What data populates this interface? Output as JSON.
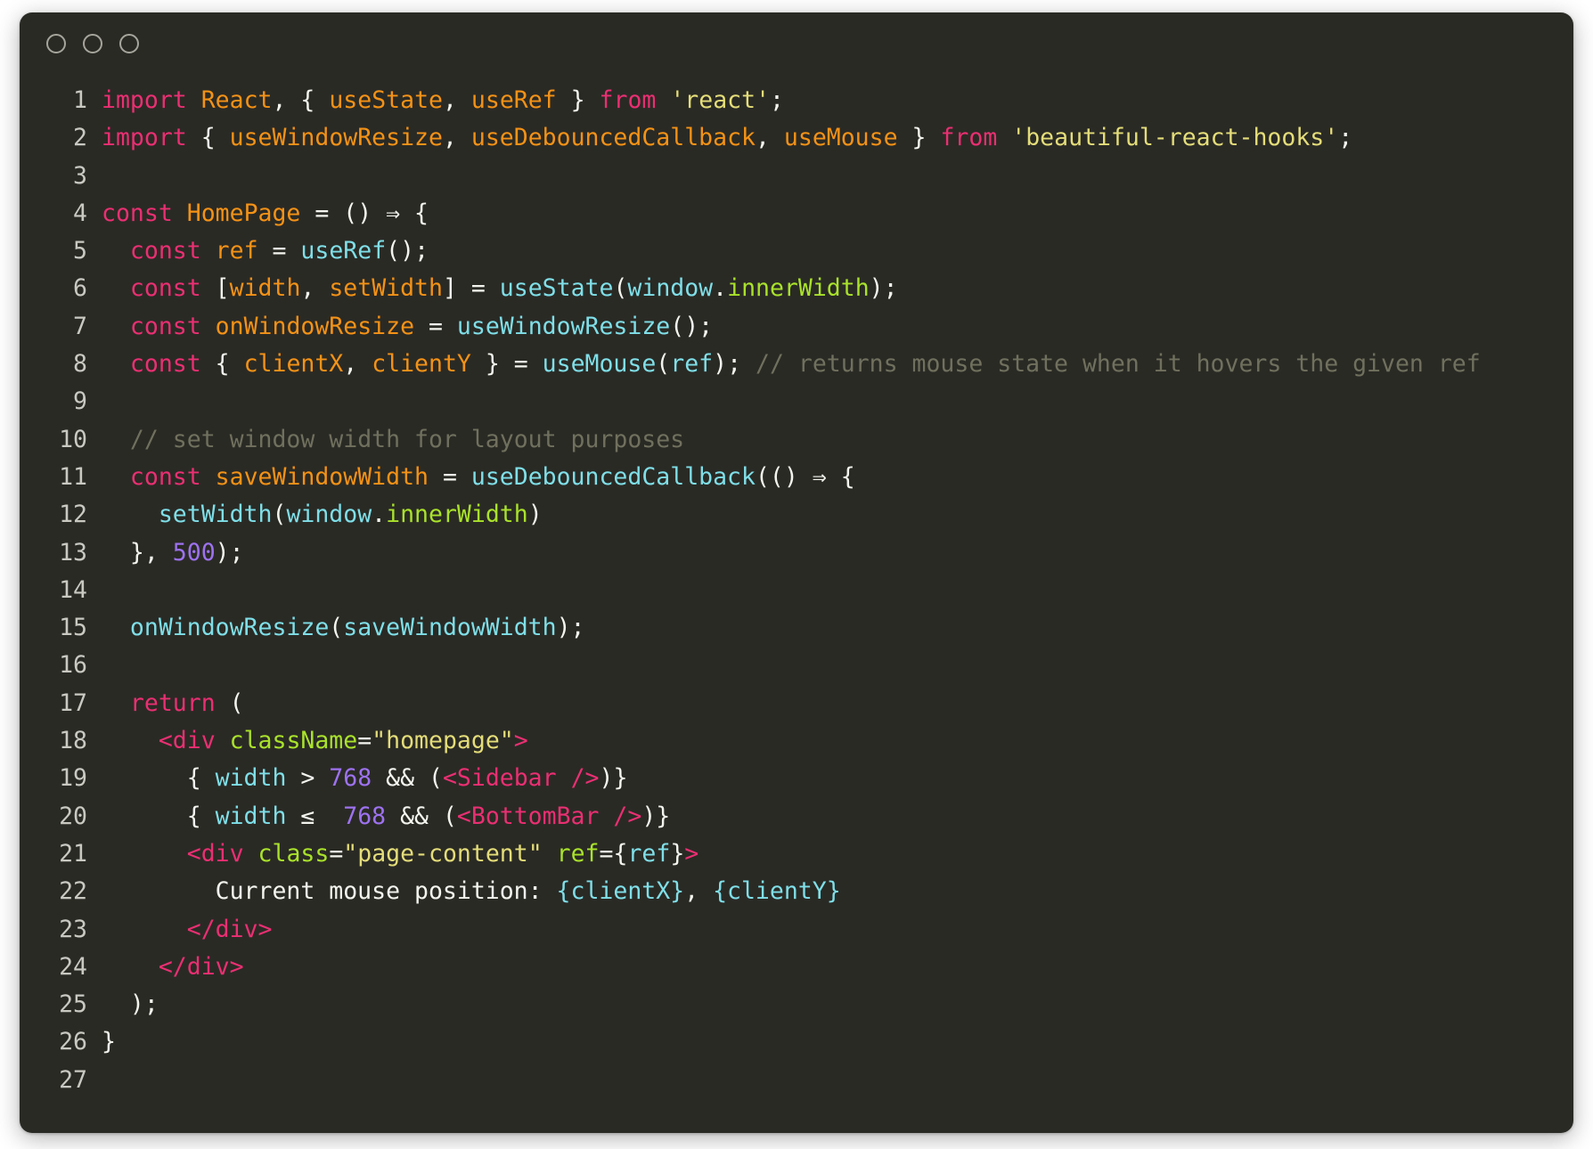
{
  "window": {
    "traffic_lights": [
      "close-button",
      "minimize-button",
      "zoom-button"
    ],
    "background_color": "#2a2a25",
    "page_background": "#ffffff"
  },
  "theme": {
    "keyword_color": "#ea2f72",
    "variable_color": "#f49216",
    "function_color": "#7fdfe8",
    "property_color": "#a9e22b",
    "string_color": "#e4dd79",
    "number_color": "#9d72f0",
    "comment_color": "#70705e",
    "plain_color": "#f4f4ee",
    "linenumber_color": "#c9c9c2"
  },
  "editor": {
    "language": "jsx",
    "line_count": 27,
    "line_numbers": [
      "1",
      "2",
      "3",
      "4",
      "5",
      "6",
      "7",
      "8",
      "9",
      "10",
      "11",
      "12",
      "13",
      "14",
      "15",
      "16",
      "17",
      "18",
      "19",
      "20",
      "21",
      "22",
      "23",
      "24",
      "25",
      "26",
      "27"
    ],
    "lines_plain": [
      "import React, { useState, useRef } from 'react';",
      "import { useWindowResize, useDebouncedCallback, useMouse } from 'beautiful-react-hooks';",
      "",
      "const HomePage = () ⇒ {",
      "  const ref = useRef();",
      "  const [width, setWidth] = useState(window.innerWidth);",
      "  const onWindowResize = useWindowResize();",
      "  const { clientX, clientY } = useMouse(ref); // returns mouse state when it hovers the given ref",
      "",
      "  // set window width for layout purposes",
      "  const saveWindowWidth = useDebouncedCallback(() ⇒ {",
      "    setWidth(window.innerWidth)",
      "  }, 500);",
      "",
      "  onWindowResize(saveWindowWidth);",
      "",
      "  return (",
      "    <div className=\"homepage\">",
      "      { width > 768 && (<Sidebar />)}",
      "      { width ≤ 768 && (<BottomBar />)}",
      "      <div class=\"page-content\" ref={ref}>",
      "        Current mouse position: {clientX}, {clientY}",
      "      </div>",
      "    </div>",
      "  );",
      "}",
      ""
    ],
    "lines_tokens": [
      [
        [
          "import",
          "kw"
        ],
        [
          " ",
          "pun"
        ],
        [
          "React",
          "var"
        ],
        [
          ", ",
          "pun"
        ],
        [
          "{",
          "pun"
        ],
        [
          " ",
          "pun"
        ],
        [
          "useState",
          "var"
        ],
        [
          ", ",
          "pun"
        ],
        [
          "useRef",
          "var"
        ],
        [
          " ",
          "pun"
        ],
        [
          "}",
          "pun"
        ],
        [
          " ",
          "pun"
        ],
        [
          "from",
          "kw"
        ],
        [
          " ",
          "pun"
        ],
        [
          "'react'",
          "str"
        ],
        [
          ";",
          "pun"
        ]
      ],
      [
        [
          "import",
          "kw"
        ],
        [
          " ",
          "pun"
        ],
        [
          "{",
          "pun"
        ],
        [
          " ",
          "pun"
        ],
        [
          "useWindowResize",
          "var"
        ],
        [
          ", ",
          "pun"
        ],
        [
          "useDebouncedCallback",
          "var"
        ],
        [
          ", ",
          "pun"
        ],
        [
          "useMouse",
          "var"
        ],
        [
          " ",
          "pun"
        ],
        [
          "}",
          "pun"
        ],
        [
          " ",
          "pun"
        ],
        [
          "from",
          "kw"
        ],
        [
          " ",
          "pun"
        ],
        [
          "'beautiful-react-hooks'",
          "str"
        ],
        [
          ";",
          "pun"
        ]
      ],
      [],
      [
        [
          "const",
          "kw"
        ],
        [
          " ",
          "pun"
        ],
        [
          "HomePage",
          "var"
        ],
        [
          " = () ⇒ {",
          "pun"
        ]
      ],
      [
        [
          "  ",
          "pun"
        ],
        [
          "const",
          "kw"
        ],
        [
          " ",
          "pun"
        ],
        [
          "ref",
          "var"
        ],
        [
          " = ",
          "pun"
        ],
        [
          "useRef",
          "fn"
        ],
        [
          "();",
          "pun"
        ]
      ],
      [
        [
          "  ",
          "pun"
        ],
        [
          "const",
          "kw"
        ],
        [
          " [",
          "pun"
        ],
        [
          "width",
          "var"
        ],
        [
          ", ",
          "pun"
        ],
        [
          "setWidth",
          "var"
        ],
        [
          "] = ",
          "pun"
        ],
        [
          "useState",
          "fn"
        ],
        [
          "(",
          "pun"
        ],
        [
          "window",
          "fn"
        ],
        [
          ".",
          "pun"
        ],
        [
          "innerWidth",
          "prop"
        ],
        [
          ");",
          "pun"
        ]
      ],
      [
        [
          "  ",
          "pun"
        ],
        [
          "const",
          "kw"
        ],
        [
          " ",
          "pun"
        ],
        [
          "onWindowResize",
          "var"
        ],
        [
          " = ",
          "pun"
        ],
        [
          "useWindowResize",
          "fn"
        ],
        [
          "();",
          "pun"
        ]
      ],
      [
        [
          "  ",
          "pun"
        ],
        [
          "const",
          "kw"
        ],
        [
          " { ",
          "pun"
        ],
        [
          "clientX",
          "var"
        ],
        [
          ", ",
          "pun"
        ],
        [
          "clientY",
          "var"
        ],
        [
          " } = ",
          "pun"
        ],
        [
          "useMouse",
          "fn"
        ],
        [
          "(",
          "pun"
        ],
        [
          "ref",
          "fn"
        ],
        [
          "); ",
          "pun"
        ],
        [
          "// returns mouse state when it hovers the given ref",
          "com"
        ]
      ],
      [],
      [
        [
          "  ",
          "pun"
        ],
        [
          "// set window width for layout purposes",
          "com"
        ]
      ],
      [
        [
          "  ",
          "pun"
        ],
        [
          "const",
          "kw"
        ],
        [
          " ",
          "pun"
        ],
        [
          "saveWindowWidth",
          "var"
        ],
        [
          " = ",
          "pun"
        ],
        [
          "useDebouncedCallback",
          "fn"
        ],
        [
          "(() ⇒ {",
          "pun"
        ]
      ],
      [
        [
          "    ",
          "pun"
        ],
        [
          "setWidth",
          "fn"
        ],
        [
          "(",
          "pun"
        ],
        [
          "window",
          "fn"
        ],
        [
          ".",
          "pun"
        ],
        [
          "innerWidth",
          "prop"
        ],
        [
          ")",
          "pun"
        ]
      ],
      [
        [
          "  }, ",
          "pun"
        ],
        [
          "500",
          "num"
        ],
        [
          ");",
          "pun"
        ]
      ],
      [],
      [
        [
          "  ",
          "pun"
        ],
        [
          "onWindowResize",
          "fn"
        ],
        [
          "(",
          "pun"
        ],
        [
          "saveWindowWidth",
          "fn"
        ],
        [
          ");",
          "pun"
        ]
      ],
      [],
      [
        [
          "  ",
          "pun"
        ],
        [
          "return",
          "kw"
        ],
        [
          " (",
          "pun"
        ]
      ],
      [
        [
          "    ",
          "pun"
        ],
        [
          "<div",
          "tag"
        ],
        [
          " ",
          "pun"
        ],
        [
          "className",
          "prop"
        ],
        [
          "=",
          "pun"
        ],
        [
          "\"homepage\"",
          "str"
        ],
        [
          ">",
          "tag"
        ]
      ],
      [
        [
          "      { ",
          "pun"
        ],
        [
          "width",
          "fn"
        ],
        [
          " > ",
          "pun"
        ],
        [
          "768",
          "num"
        ],
        [
          " && (",
          "pun"
        ],
        [
          "<Sidebar",
          "tag"
        ],
        [
          " ",
          "pun"
        ],
        [
          "/>",
          "tag"
        ],
        [
          ")}",
          "pun"
        ]
      ],
      [
        [
          "      { ",
          "pun"
        ],
        [
          "width",
          "fn"
        ],
        [
          " ≤  ",
          "pun"
        ],
        [
          "768",
          "num"
        ],
        [
          " && (",
          "pun"
        ],
        [
          "<BottomBar",
          "tag"
        ],
        [
          " ",
          "pun"
        ],
        [
          "/>",
          "tag"
        ],
        [
          ")}",
          "pun"
        ]
      ],
      [
        [
          "      ",
          "pun"
        ],
        [
          "<div",
          "tag"
        ],
        [
          " ",
          "pun"
        ],
        [
          "class",
          "prop"
        ],
        [
          "=",
          "pun"
        ],
        [
          "\"page-content\"",
          "str"
        ],
        [
          " ",
          "pun"
        ],
        [
          "ref",
          "prop"
        ],
        [
          "=",
          "pun"
        ],
        [
          "{",
          "pun"
        ],
        [
          "ref",
          "fn"
        ],
        [
          "}",
          "pun"
        ],
        [
          ">",
          "tag"
        ]
      ],
      [
        [
          "        Current mouse position: ",
          "pun"
        ],
        [
          "{clientX}",
          "fn"
        ],
        [
          ", ",
          "pun"
        ],
        [
          "{clientY}",
          "fn"
        ]
      ],
      [
        [
          "      ",
          "pun"
        ],
        [
          "</div>",
          "tag"
        ]
      ],
      [
        [
          "    ",
          "pun"
        ],
        [
          "</div>",
          "tag"
        ]
      ],
      [
        [
          "  );",
          "pun"
        ]
      ],
      [
        [
          "}",
          "pun"
        ]
      ],
      []
    ]
  }
}
